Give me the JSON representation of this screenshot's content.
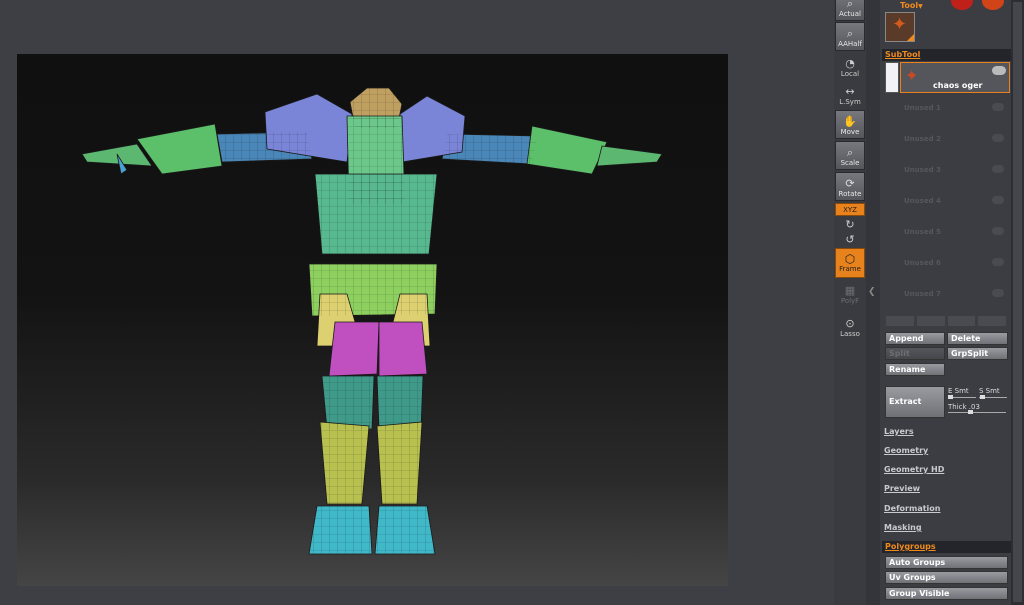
{
  "shelf": {
    "actual": "Actual",
    "aahalf": "AAHalf",
    "local": "Local",
    "lsym": "L.Sym",
    "move": "Move",
    "scale": "Scale",
    "rotate": "Rotate",
    "xyz": "XYZ",
    "frame": "Frame",
    "poly": "PolyF",
    "lasso": "Lasso"
  },
  "tool": {
    "label": "Tool"
  },
  "subtool": {
    "header": "SubTool",
    "active_name": "chaos oger",
    "unused": [
      "Unused 1",
      "Unused 2",
      "Unused 3",
      "Unused 4",
      "Unused 5",
      "Unused 6",
      "Unused 7"
    ],
    "buttons": {
      "append": "Append",
      "delete": "Delete",
      "split": "Split",
      "grpsplit": "GrpSplit",
      "rename": "Rename",
      "extract": "Extract"
    },
    "sliders": {
      "e_smt": "E Smt",
      "s_smt": "S Smt",
      "thick": "Thick .03"
    }
  },
  "menus": [
    "Layers",
    "Geometry",
    "Geometry HD",
    "Preview",
    "Deformation",
    "Masking"
  ],
  "polygroups": {
    "header": "Polygroups",
    "buttons": [
      "Auto Groups",
      "Uv Groups",
      "Group Visible"
    ]
  },
  "colors": {
    "accent": "#f08a1e",
    "frame_button": "#e8821c"
  }
}
